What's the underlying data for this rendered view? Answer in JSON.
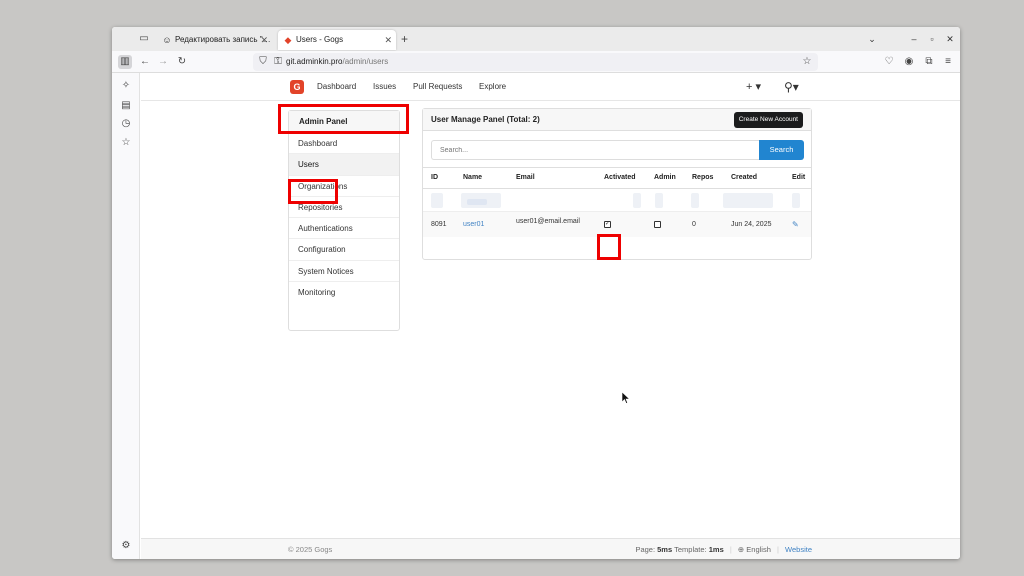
{
  "browser": {
    "tabs": [
      {
        "title": "Редактировать запись \"…",
        "active": false,
        "icon": "person-icon"
      },
      {
        "title": "Users - Gogs",
        "active": true,
        "icon": "gogs-icon"
      }
    ],
    "url_host": "git.adminkin.pro",
    "url_path": "/admin/users"
  },
  "header": {
    "logo_text": "G",
    "menu": [
      "Dashboard",
      "Issues",
      "Pull Requests",
      "Explore"
    ],
    "plus_label": "+ ▾",
    "user_label": "⚲▾"
  },
  "admin_menu": {
    "title": "Admin Panel",
    "items": [
      "Dashboard",
      "Users",
      "Organizations",
      "Repositories",
      "Authentications",
      "Configuration",
      "System Notices",
      "Monitoring"
    ],
    "active_index": 1
  },
  "panel": {
    "title": "User Manage Panel (Total: 2)",
    "create_button": "Create New Account",
    "search_placeholder": "Search...",
    "search_button": "Search",
    "columns": [
      "ID",
      "Name",
      "Email",
      "Activated",
      "Admin",
      "Repos",
      "Created",
      "Edit"
    ],
    "rows": [
      {
        "id": "8091",
        "name": "user01",
        "email": "user01@email.email",
        "activated": true,
        "admin": false,
        "repos": "0",
        "created": "Jun 24, 2025"
      }
    ]
  },
  "footer": {
    "copyright": "© 2025 Gogs",
    "page_label": "Page:",
    "page_time": "5ms",
    "template_label": "Template:",
    "template_time": "1ms",
    "language": "English",
    "website": "Website"
  },
  "colors": {
    "accent": "#2185d0",
    "link": "#4183c4",
    "highlight": "#ee0000",
    "logo": "#e24329"
  }
}
